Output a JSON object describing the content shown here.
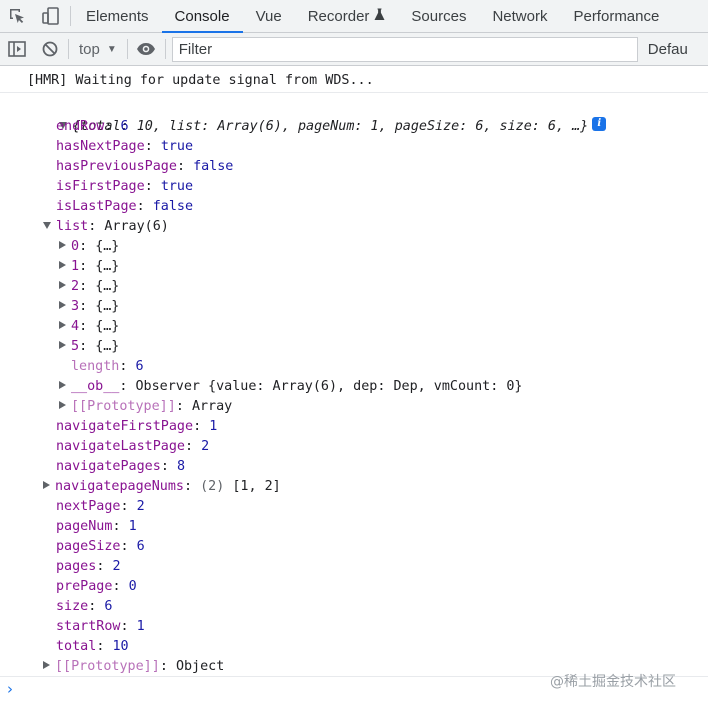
{
  "tabbar": {
    "tabs": [
      {
        "label": "Elements"
      },
      {
        "label": "Console",
        "active": true
      },
      {
        "label": "Vue"
      },
      {
        "label": "Recorder"
      },
      {
        "label": "Sources"
      },
      {
        "label": "Network"
      },
      {
        "label": "Performance"
      }
    ],
    "recorder_icon": "flask-icon"
  },
  "toolbar": {
    "context": "top",
    "filter_placeholder": "Filter",
    "levels_label": "Defau"
  },
  "console": {
    "message": "[HMR] Waiting for update signal from WDS...",
    "summary": "{total: 10, list: Array(6), pageNum: 1, pageSize: 6, size: 6, …}",
    "props": [
      {
        "key": "endRow",
        "value": "6"
      },
      {
        "key": "hasNextPage",
        "value": "true"
      },
      {
        "key": "hasPreviousPage",
        "value": "false"
      },
      {
        "key": "isFirstPage",
        "value": "true"
      },
      {
        "key": "isLastPage",
        "value": "false"
      }
    ],
    "list": {
      "key": "list",
      "value": "Array(6)",
      "items": [
        {
          "key": "0",
          "value": "{…}"
        },
        {
          "key": "1",
          "value": "{…}"
        },
        {
          "key": "2",
          "value": "{…}"
        },
        {
          "key": "3",
          "value": "{…}"
        },
        {
          "key": "4",
          "value": "{…}"
        },
        {
          "key": "5",
          "value": "{…}"
        }
      ],
      "length_key": "length",
      "length_value": "6",
      "ob_key": "__ob__",
      "ob_value": "Observer {value: Array(6), dep: Dep, vmCount: 0}",
      "proto_key": "[[Prototype]]",
      "proto_value": "Array"
    },
    "props2": [
      {
        "key": "navigateFirstPage",
        "value": "1"
      },
      {
        "key": "navigateLastPage",
        "value": "2"
      },
      {
        "key": "navigatePages",
        "value": "8"
      }
    ],
    "navnums": {
      "key": "navigatepageNums",
      "count": "(2)",
      "value": "[1, 2]"
    },
    "props3": [
      {
        "key": "nextPage",
        "value": "2"
      },
      {
        "key": "pageNum",
        "value": "1"
      },
      {
        "key": "pageSize",
        "value": "6"
      },
      {
        "key": "pages",
        "value": "2"
      },
      {
        "key": "prePage",
        "value": "0"
      },
      {
        "key": "size",
        "value": "6"
      },
      {
        "key": "startRow",
        "value": "1"
      },
      {
        "key": "total",
        "value": "10"
      }
    ],
    "proto": {
      "key": "[[Prototype]]",
      "value": "Object"
    },
    "prompt_symbol": "›"
  },
  "watermark": "@稀土掘金技术社区",
  "colors": {
    "accent": "#1a73e8",
    "key": "#881391",
    "value": "#1a1aa6"
  }
}
